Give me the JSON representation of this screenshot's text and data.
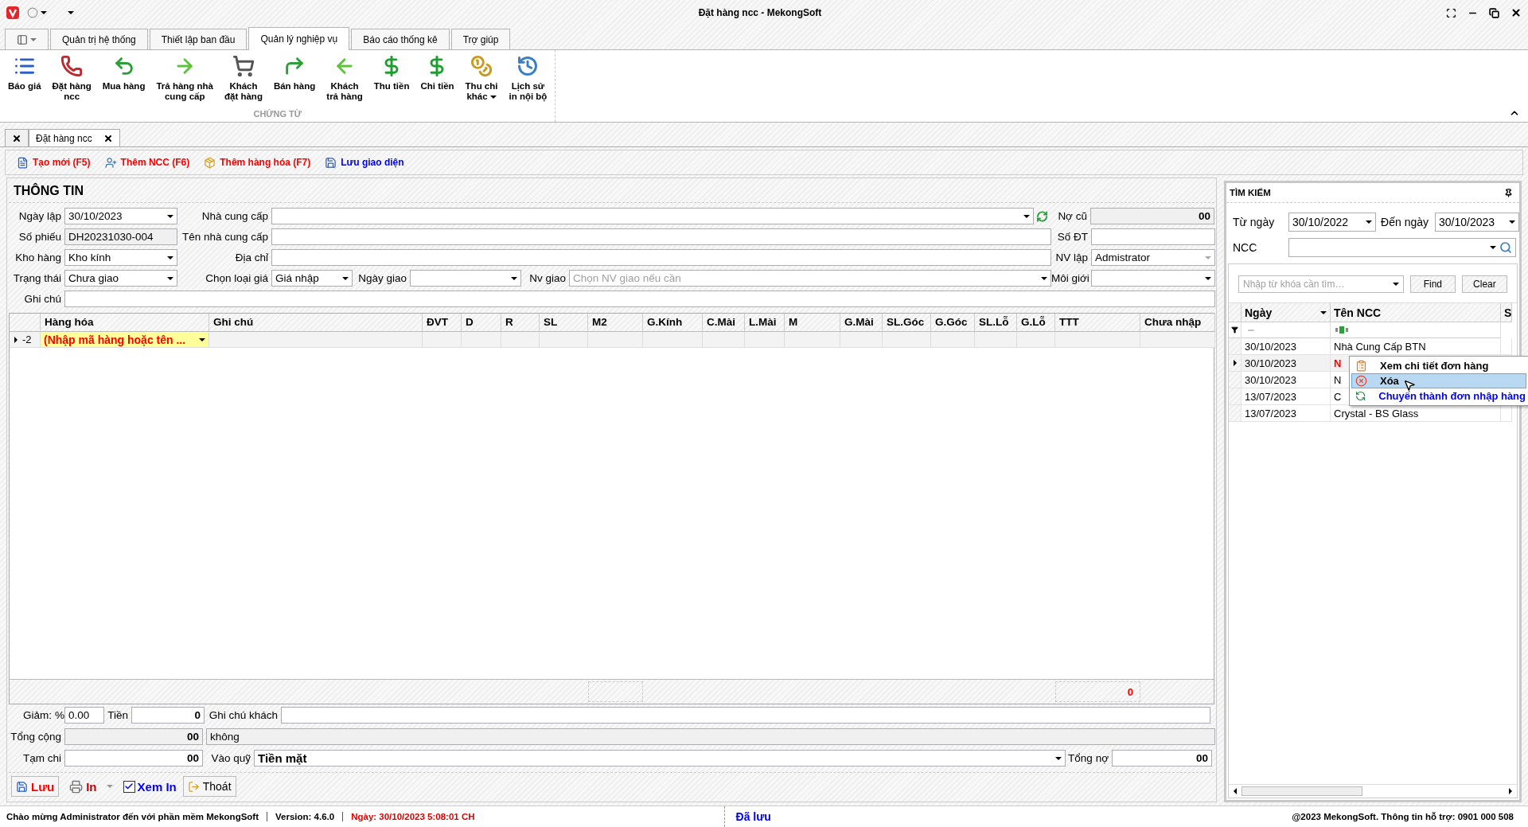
{
  "window": {
    "title": "Đặt hàng ncc - MekongSoft"
  },
  "ribbon": {
    "tabs": [
      {
        "label": "Quản trị hệ thống",
        "selected": false
      },
      {
        "label": "Thiết lập ban đầu",
        "selected": false
      },
      {
        "label": "Quản lý nghiệp vụ",
        "selected": true
      },
      {
        "label": "Báo cáo thống kê",
        "selected": false
      },
      {
        "label": "Trợ giúp",
        "selected": false
      }
    ],
    "buttons": [
      {
        "label": "Báo giá",
        "dropdown": false
      },
      {
        "label": "Đặt hàng\nncc",
        "dropdown": false
      },
      {
        "label": "Mua hàng",
        "dropdown": false
      },
      {
        "label": "Trả hàng nhà\ncung cấp",
        "dropdown": false
      },
      {
        "label": "Khách\nđặt hàng",
        "dropdown": false
      },
      {
        "label": "Bán hàng",
        "dropdown": false
      },
      {
        "label": "Khách\ntrả hàng",
        "dropdown": false
      },
      {
        "label": "Thu tiền",
        "dropdown": false
      },
      {
        "label": "Chi tiền",
        "dropdown": false
      },
      {
        "label": "Thu chi\nkhác",
        "dropdown": true
      },
      {
        "label": "Lịch sử\nin nội bộ",
        "dropdown": false
      }
    ],
    "group": "CHỨNG TỪ"
  },
  "document_tabs": [
    {
      "label": "Đặt hàng ncc",
      "selected": true
    }
  ],
  "toolbar": [
    {
      "label": "Tạo mới (F5)",
      "color": "#ff0000"
    },
    {
      "label": "Thêm NCC (F6)",
      "color": "#ff0000"
    },
    {
      "label": "Thêm hàng hóa (F7)",
      "color": "#ff0000"
    },
    {
      "label": "Lưu giao diện",
      "color": "#0000ff"
    }
  ],
  "info": {
    "title": "THÔNG TIN",
    "rows": [
      [
        {
          "label": "Ngày lập",
          "kind": "dropdown",
          "value": "30/10/2023"
        },
        {
          "label": "Nhà cung cấp",
          "kind": "supplier"
        },
        {
          "label": "Nợ cũ",
          "kind": "amount",
          "value": "00"
        }
      ],
      [
        {
          "label": "Số phiếu",
          "kind": "readonly",
          "value": "DH20231030-004"
        },
        {
          "label": "Tên nhà cung cấp",
          "kind": "text"
        },
        {
          "label": "Số ĐT",
          "kind": "text"
        }
      ],
      [
        {
          "label": "Kho hàng",
          "kind": "dropdown",
          "value": "Kho kính"
        },
        {
          "label": "Địa chỉ",
          "kind": "text"
        },
        {
          "label": "NV lập",
          "kind": "locked",
          "value": "Admistrator"
        }
      ],
      [
        {
          "label": "Trạng thái",
          "kind": "dropdown",
          "value": "Chưa giao"
        },
        {
          "label": "Chọn loại giá",
          "kind": "dropdown",
          "value": "Giá nhập"
        },
        {
          "label": "Ngày giao",
          "kind": "dropdown"
        },
        {
          "label": "Nv giao",
          "kind": "dropdown",
          "placeholder": "Chọn NV giao nếu cần"
        },
        {
          "label": "Môi giới",
          "kind": "dropdown"
        }
      ],
      [
        {
          "label": "Ghi chú",
          "kind": "text"
        }
      ]
    ]
  },
  "grid": {
    "columns": [
      "Hàng hóa",
      "Ghi chú",
      "ĐVT",
      "D",
      "R",
      "SL",
      "M2",
      "G.Kính",
      "C.Mài",
      "L.Mài",
      "M",
      "G.Mài",
      "SL.Góc",
      "G.Góc",
      "SL.Lỗ",
      "G.Lỗ",
      "TTT",
      "Chưa nhập"
    ],
    "rows": [
      {
        "header": "-2",
        "item": "(Nhập mã hàng hoặc tên ..."
      }
    ],
    "footer_total": "0"
  },
  "totals": {
    "discount_label": "Giảm:",
    "percent_sign": "%",
    "discount_percent": "0.00",
    "amount_label": "Tiền",
    "amount": "0",
    "customer_note_label": "Ghi chú khách",
    "total_label": "Tổng cộng",
    "total": "00",
    "total_in_words": "không",
    "advance_label": "Tạm chi",
    "advance": "00",
    "fund_label": "Vào quỹ",
    "fund": "Tiền mặt",
    "debt_label": "Tổng nợ",
    "debt": "00"
  },
  "actions": [
    {
      "label": "Lưu",
      "kind": "button",
      "color": "#ff0000"
    },
    {
      "label": "In",
      "kind": "split",
      "color": "#c00000"
    },
    {
      "label": "Xem In",
      "kind": "checkbox",
      "checked": true,
      "color": "#0000ff"
    },
    {
      "label": "Thoát",
      "kind": "button",
      "color": "#000000"
    }
  ],
  "search_panel": {
    "title": "TÌM KIẾM",
    "from_label": "Từ ngày",
    "from": "30/10/2022",
    "to_label": "Đến ngày",
    "to": "30/10/2023",
    "supplier_label": "NCC",
    "keyword_placeholder": "Nhập từ khóa cần tìm…",
    "find": "Find",
    "clear": "Clear",
    "columns": [
      "Ngày",
      "Tên NCC",
      "S"
    ],
    "rows": [
      {
        "date": "30/10/2023",
        "supplier": "Nhà Cung Cấp BTN",
        "highlighted": false,
        "selected": false
      },
      {
        "date": "30/10/2023",
        "supplier": "N",
        "highlighted": true,
        "selected": true
      },
      {
        "date": "30/10/2023",
        "supplier": "N",
        "highlighted": false,
        "selected": false
      },
      {
        "date": "13/07/2023",
        "supplier": "C",
        "highlighted": false,
        "selected": false
      },
      {
        "date": "13/07/2023",
        "supplier": "Crystal - BS Glass",
        "highlighted": false,
        "selected": false
      }
    ]
  },
  "context_menu": [
    {
      "label": "Xem chi tiết đơn hàng",
      "selected": false,
      "color": "#000000"
    },
    {
      "label": "Xóa",
      "selected": true,
      "color": "#000000"
    },
    {
      "label": "Chuyển thành đơn nhập hàng",
      "selected": false,
      "color": "#0000ff"
    }
  ],
  "status_bar": {
    "welcome": "Chào mừng Administrator đến với phần mềm MekongSoft",
    "version": "Version: 4.6.0",
    "date": "Ngày: 30/10/2023 5:08:01 CH",
    "state": "Đã lưu",
    "copyright": "@2023 MekongSoft. Thông tin hỗ trợ: 0901 000 508"
  }
}
